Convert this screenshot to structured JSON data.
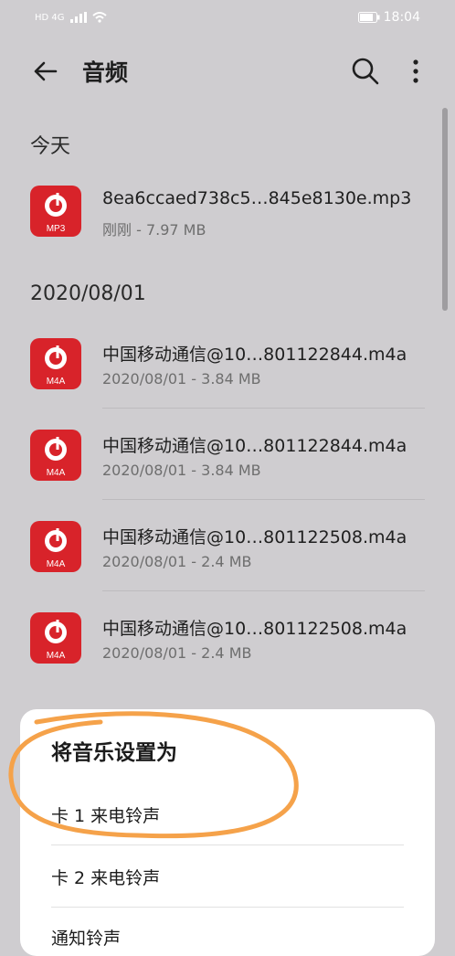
{
  "status_bar": {
    "left": "HD 4G",
    "time": "18:04"
  },
  "app_bar": {
    "title": "音频",
    "back_icon": "back-arrow-icon",
    "search_icon": "search-icon",
    "more_icon": "more-vertical-icon"
  },
  "sections": [
    {
      "header": "今天",
      "files": [
        {
          "name": "8ea6ccaed738c5…845e8130e.mp3",
          "meta": "刚刚 - 7.97 MB",
          "type": "MP3"
        }
      ]
    },
    {
      "header": "2020/08/01",
      "files": [
        {
          "name": "中国移动通信@10…801122844.m4a",
          "meta": "2020/08/01 - 3.84 MB",
          "type": "M4A"
        },
        {
          "name": "中国移动通信@10…801122844.m4a",
          "meta": "2020/08/01 - 3.84 MB",
          "type": "M4A"
        },
        {
          "name": "中国移动通信@10…801122508.m4a",
          "meta": "2020/08/01 - 2.4 MB",
          "type": "M4A"
        },
        {
          "name": "中国移动通信@10…801122508.m4a",
          "meta": "2020/08/01 - 2.4 MB",
          "type": "M4A"
        }
      ]
    }
  ],
  "sheet": {
    "title": "将音乐设置为",
    "items": [
      "卡 1 来电铃声",
      "卡 2 来电铃声",
      "通知铃声"
    ]
  },
  "colors": {
    "background": "#cfcdd0",
    "icon_red": "#d8232a",
    "annotation_orange": "#f5a24a"
  }
}
